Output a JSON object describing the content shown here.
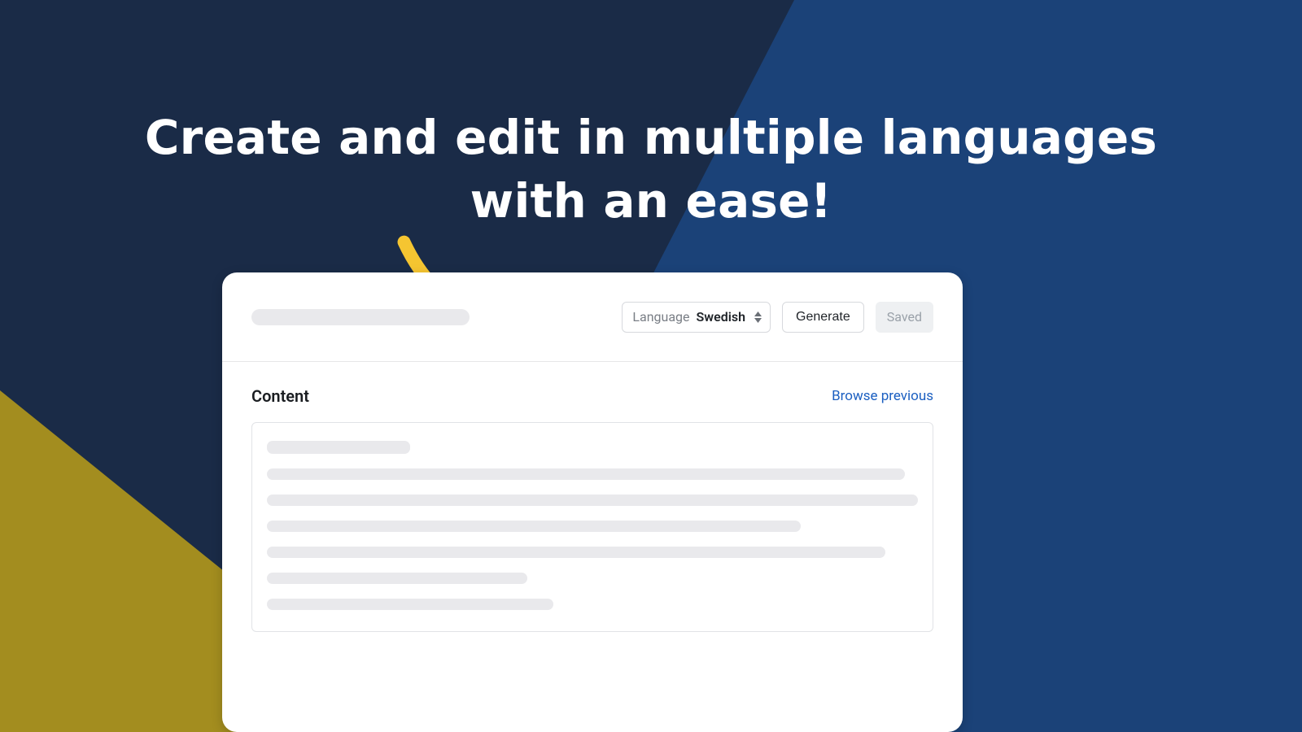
{
  "hero": {
    "headline_line1": "Create and edit in multiple languages",
    "headline_line2": "with an ease!"
  },
  "toolbar": {
    "language_label": "Language",
    "language_value": "Swedish",
    "generate_label": "Generate",
    "saved_label": "Saved"
  },
  "content": {
    "section_label": "Content",
    "browse_link": "Browse previous"
  },
  "colors": {
    "bg_dark": "#1a2b47",
    "bg_blue": "#1b4278",
    "accent_olive": "#a38d1f",
    "arrow": "#f5c531",
    "link": "#1b5fc1"
  },
  "skeleton_widths_pct": [
    22,
    98,
    100,
    82,
    95,
    40,
    44
  ]
}
